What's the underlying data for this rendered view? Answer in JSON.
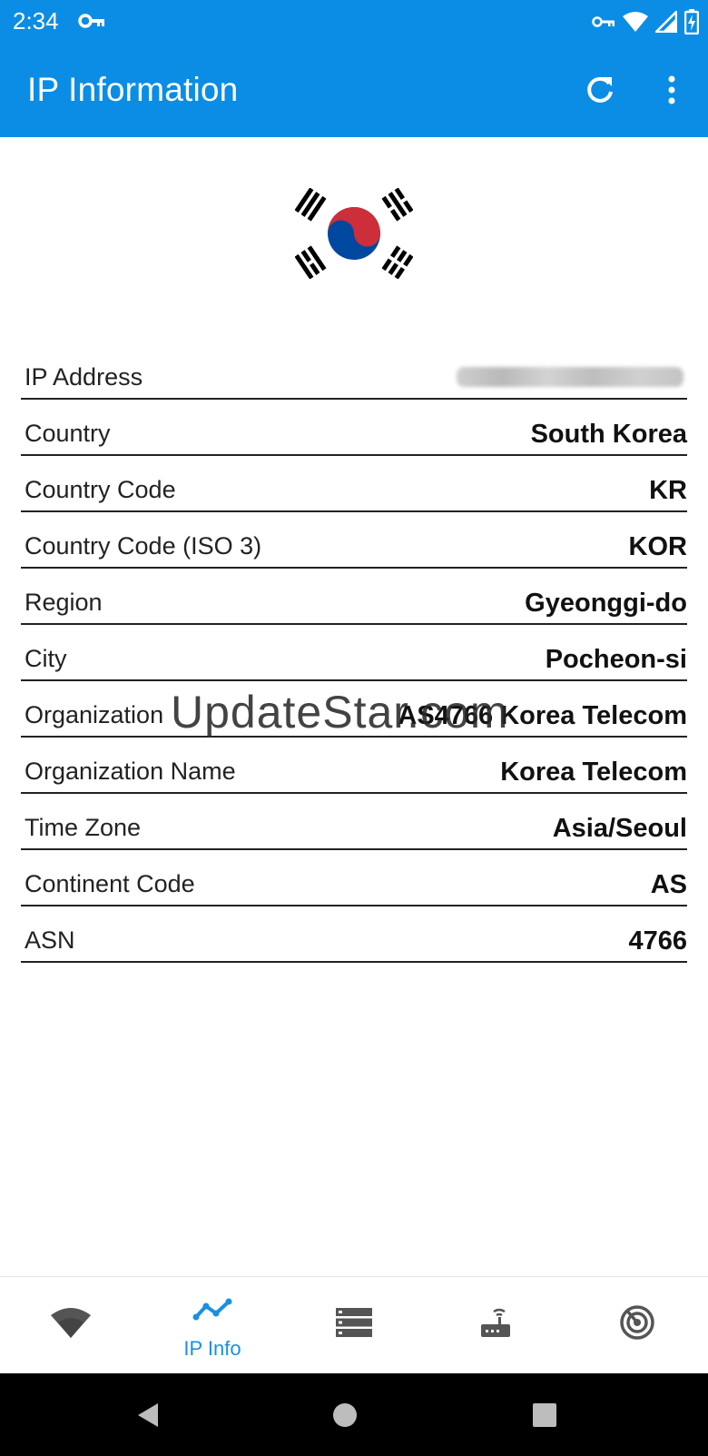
{
  "status_bar": {
    "time": "2:34",
    "icons": [
      "vpn-key-icon",
      "wifi-icon",
      "signal-icon",
      "battery-charging-icon"
    ]
  },
  "app_bar": {
    "title": "IP Information",
    "actions": [
      "refresh-icon",
      "more-vert-icon"
    ]
  },
  "flag": {
    "country": "South Korea",
    "colors": {
      "red": "#cd2e3a",
      "blue": "#0047a0",
      "black": "#000000"
    }
  },
  "info": [
    {
      "label": "IP Address",
      "value": ""
    },
    {
      "label": "Country",
      "value": "South Korea"
    },
    {
      "label": "Country Code",
      "value": "KR"
    },
    {
      "label": "Country Code (ISO 3)",
      "value": "KOR"
    },
    {
      "label": "Region",
      "value": "Gyeonggi-do"
    },
    {
      "label": "City",
      "value": "Pocheon-si"
    },
    {
      "label": "Organization",
      "value": "AS4766 Korea Telecom"
    },
    {
      "label": "Organization Name",
      "value": "Korea Telecom"
    },
    {
      "label": "Time Zone",
      "value": "Asia/Seoul"
    },
    {
      "label": "Continent Code",
      "value": "AS"
    },
    {
      "label": "ASN",
      "value": "4766"
    }
  ],
  "watermark": "UpdateStar.com",
  "bottom_nav": {
    "items": [
      {
        "icon": "wifi-icon",
        "label": ""
      },
      {
        "icon": "chart-line-icon",
        "label": "IP Info",
        "active": true
      },
      {
        "icon": "server-list-icon",
        "label": ""
      },
      {
        "icon": "router-icon",
        "label": ""
      },
      {
        "icon": "radar-icon",
        "label": ""
      }
    ]
  },
  "colors": {
    "primary": "#0b8de6",
    "active": "#1a8fe0",
    "inactive": "#555555"
  }
}
